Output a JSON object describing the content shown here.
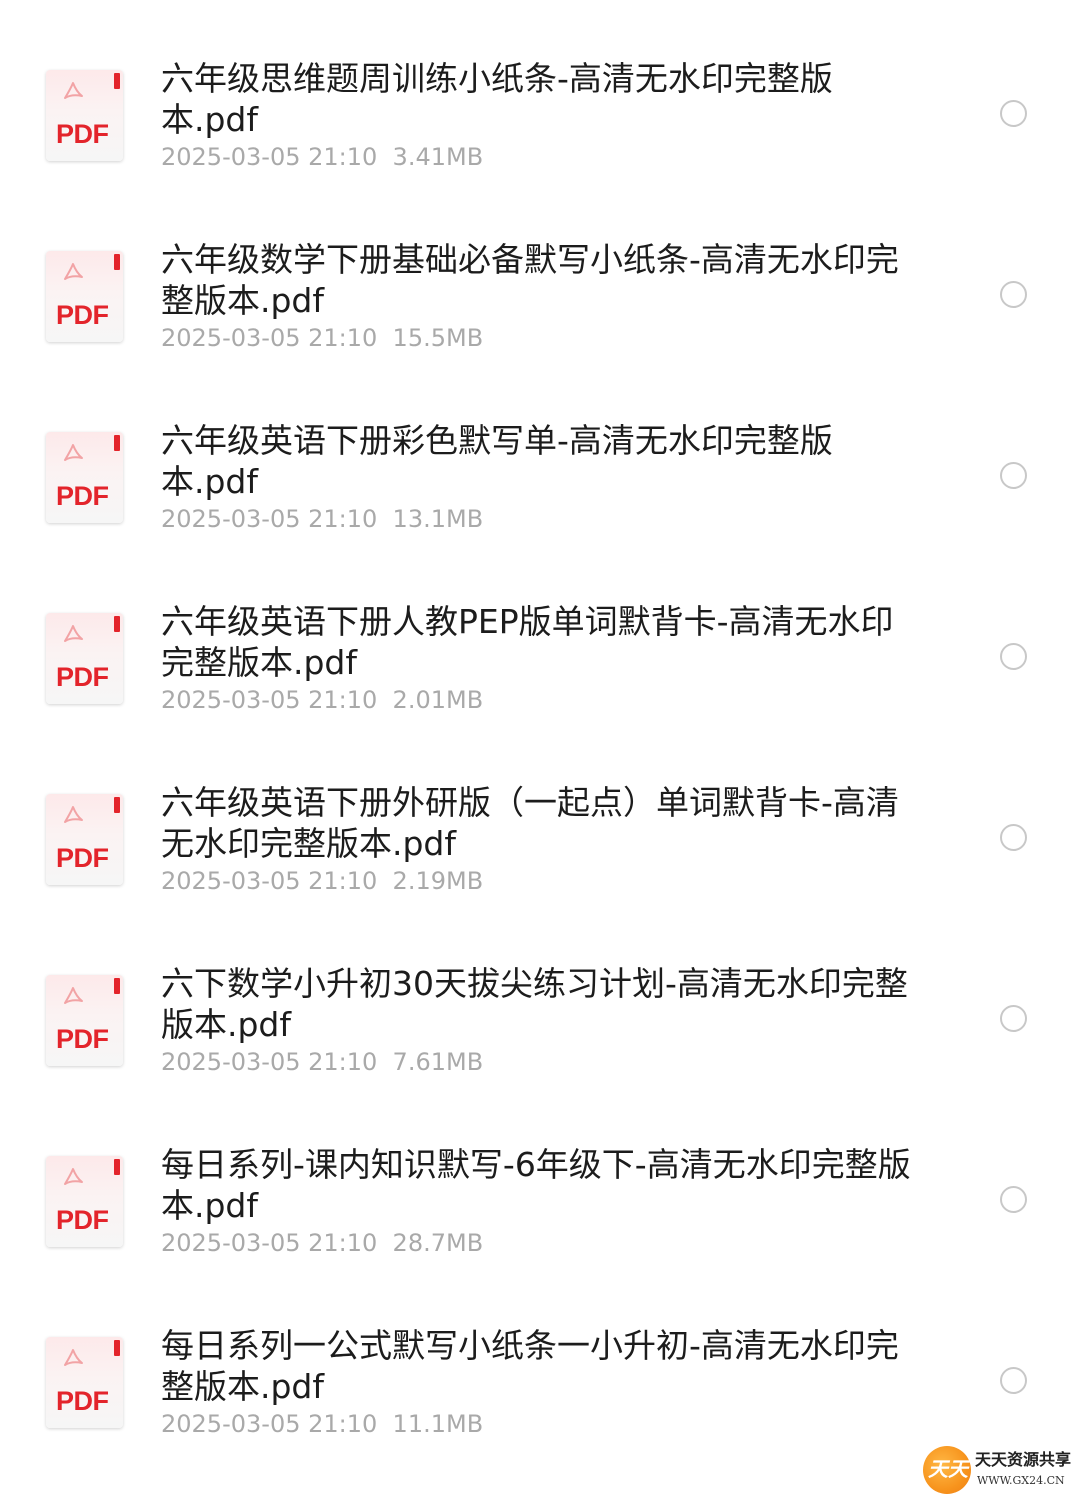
{
  "icon_label": "PDF",
  "icon_name": "pdf-file-icon",
  "radio_icon": "radio-unchecked-icon",
  "colors": {
    "pdf_red": "#e3242b",
    "title_text": "#1c1c1c",
    "meta_text": "#a9a9a9",
    "radio_border": "#c8c8c8",
    "watermark_orange": "#f7941d"
  },
  "files": [
    {
      "name": "六年级思维题周训练小纸条-高清无水印完整版本.pdf",
      "date": "2025-03-05 21:10",
      "size": "3.41MB",
      "selected": false
    },
    {
      "name": "六年级数学下册基础必备默写小纸条-高清无水印完整版本.pdf",
      "date": "2025-03-05 21:10",
      "size": "15.5MB",
      "selected": false
    },
    {
      "name": "六年级英语下册彩色默写单-高清无水印完整版本.pdf",
      "date": "2025-03-05 21:10",
      "size": "13.1MB",
      "selected": false
    },
    {
      "name": "六年级英语下册人教PEP版单词默背卡-高清无水印完整版本.pdf",
      "date": "2025-03-05 21:10",
      "size": "2.01MB",
      "selected": false
    },
    {
      "name": "六年级英语下册外研版（一起点）单词默背卡-高清无水印完整版本.pdf",
      "date": "2025-03-05 21:10",
      "size": "2.19MB",
      "selected": false
    },
    {
      "name": "六下数学小升初30天拔尖练习计划-高清无水印完整版本.pdf",
      "date": "2025-03-05 21:10",
      "size": "7.61MB",
      "selected": false
    },
    {
      "name": "每日系列-课内知识默写-6年级下-高清无水印完整版本.pdf",
      "date": "2025-03-05 21:10",
      "size": "28.7MB",
      "selected": false
    },
    {
      "name": "每日系列一公式默写小纸条一小升初-高清无水印完整版本.pdf",
      "date": "2025-03-05 21:10",
      "size": "11.1MB",
      "selected": false
    }
  ],
  "watermark": {
    "logo_text": "天天",
    "title": "天天资源共享",
    "url": "WWW.GX24.CN"
  }
}
